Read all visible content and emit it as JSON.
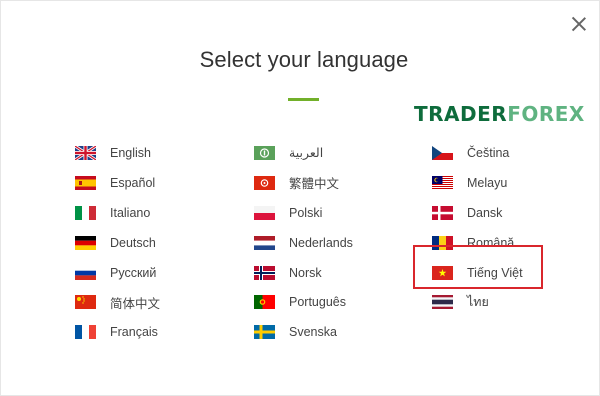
{
  "dialog": {
    "title": "Select your language",
    "close_label": "×"
  },
  "watermark": {
    "part1": "TRADER",
    "part2": "FOREX"
  },
  "colors": {
    "accent": "#72b02a",
    "highlight": "#d9262c"
  },
  "languages": {
    "col1": [
      {
        "label": "English",
        "flag": "gb-flag-icon"
      },
      {
        "label": "Español",
        "flag": "es-flag-icon"
      },
      {
        "label": "Italiano",
        "flag": "it-flag-icon"
      },
      {
        "label": "Deutsch",
        "flag": "de-flag-icon"
      },
      {
        "label": "Русский",
        "flag": "ru-flag-icon"
      },
      {
        "label": "简体中文",
        "flag": "cn-flag-icon"
      },
      {
        "label": "Français",
        "flag": "fr-flag-icon"
      }
    ],
    "col2": [
      {
        "label": "العربية",
        "flag": "sa-flag-icon"
      },
      {
        "label": "繁體中文",
        "flag": "hk-flag-icon"
      },
      {
        "label": "Polski",
        "flag": "pl-flag-icon"
      },
      {
        "label": "Nederlands",
        "flag": "nl-flag-icon"
      },
      {
        "label": "Norsk",
        "flag": "no-flag-icon"
      },
      {
        "label": "Português",
        "flag": "pt-flag-icon"
      },
      {
        "label": "Svenska",
        "flag": "se-flag-icon"
      }
    ],
    "col3": [
      {
        "label": "Čeština",
        "flag": "cz-flag-icon"
      },
      {
        "label": "Melayu",
        "flag": "my-flag-icon"
      },
      {
        "label": "Dansk",
        "flag": "dk-flag-icon"
      },
      {
        "label": "Română",
        "flag": "ro-flag-icon"
      },
      {
        "label": "Tiếng Việt",
        "flag": "vn-flag-icon"
      },
      {
        "label": "ไทย",
        "flag": "th-flag-icon"
      }
    ]
  }
}
